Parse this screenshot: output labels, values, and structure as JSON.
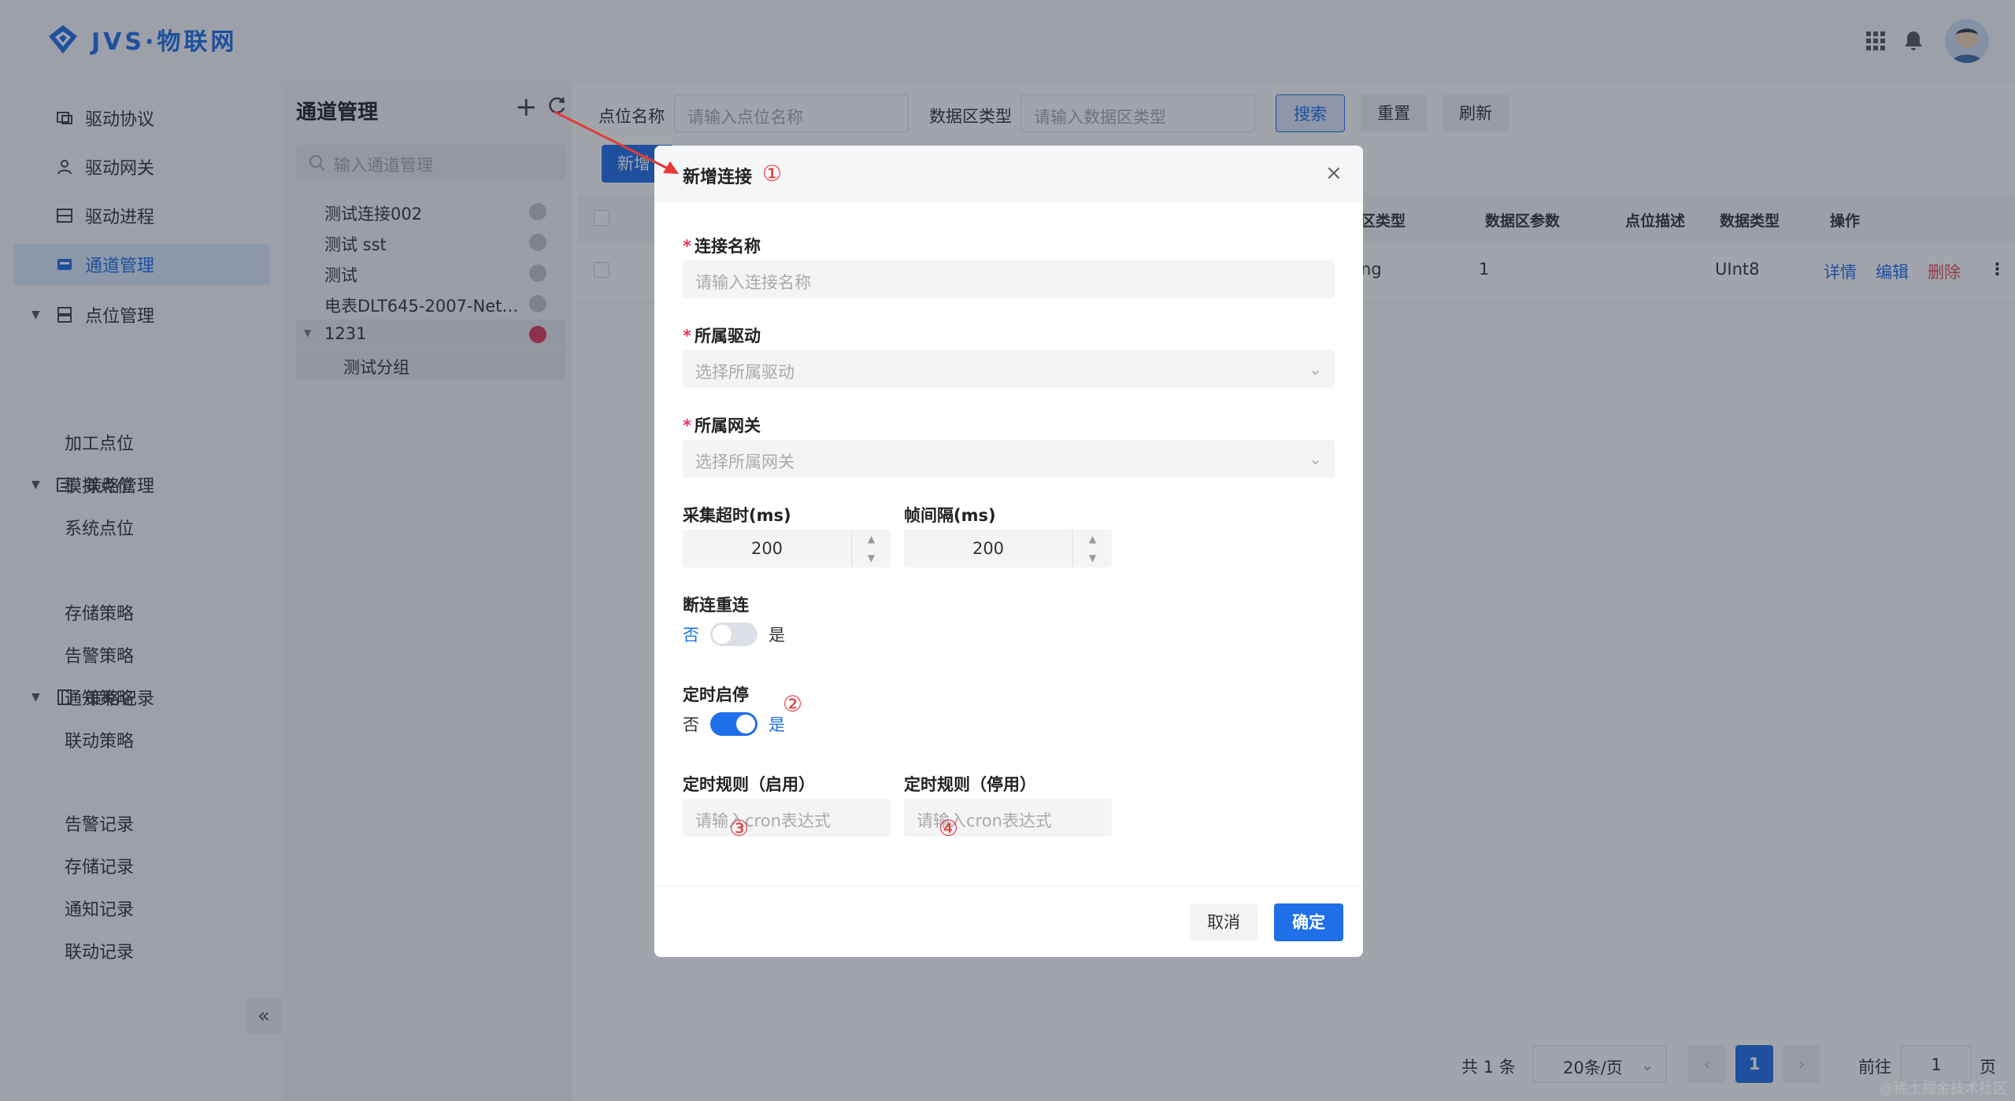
{
  "app": {
    "title": "JVS·物联网"
  },
  "nav": {
    "items": [
      {
        "label": "驱动协议",
        "icon": "protocol-icon"
      },
      {
        "label": "驱动网关",
        "icon": "gateway-icon"
      },
      {
        "label": "驱动进程",
        "icon": "process-icon"
      },
      {
        "label": "通道管理",
        "icon": "channel-icon",
        "active": true
      }
    ],
    "groups": [
      {
        "label": "点位管理",
        "icon": "point-icon",
        "children": [
          "加工点位",
          "模拟点位",
          "系统点位"
        ]
      },
      {
        "label": "策略管理",
        "icon": "strategy-icon",
        "children": [
          "存储策略",
          "告警策略",
          "通知策略",
          "联动策略"
        ]
      },
      {
        "label": "策略记录",
        "icon": "record-icon",
        "children": [
          "告警记录",
          "存储记录",
          "通知记录",
          "联动记录"
        ]
      }
    ],
    "collapse": "«"
  },
  "tree": {
    "title": "通道管理",
    "search_placeholder": "输入通道管理",
    "nodes": [
      "测试连接002",
      "测试 sst",
      "测试",
      "电表DLT645-2007-Net…",
      "1231",
      "测试分组"
    ]
  },
  "filters": {
    "point_name_label": "点位名称",
    "point_name_placeholder": "请输入点位名称",
    "data_type_label": "数据区类型",
    "data_type_placeholder": "请输入数据区类型",
    "search": "搜索",
    "reset": "重置",
    "refresh": "刷新",
    "new": "新增"
  },
  "table": {
    "headers": [
      "区类型",
      "数据区参数",
      "点位描述",
      "数据类型",
      "操作"
    ],
    "row": {
      "type": "ng",
      "param": "1",
      "dtype": "UInt8",
      "detail": "详情",
      "edit": "编辑",
      "delete": "删除"
    }
  },
  "pager": {
    "total": "共 1 条",
    "size": "20条/页",
    "current": "1",
    "goto": "前往",
    "page_input": "1",
    "page_unit": "页"
  },
  "dialog": {
    "title": "新增连接",
    "close": "×",
    "conn_name_label": "连接名称",
    "conn_name_placeholder": "请输入连接名称",
    "driver_label": "所属驱动",
    "driver_placeholder": "选择所属驱动",
    "gateway_label": "所属网关",
    "gateway_placeholder": "选择所属网关",
    "timeout_label": "采集超时(ms)",
    "timeout_value": "200",
    "interval_label": "帧间隔(ms)",
    "interval_value": "200",
    "reconnect_label": "断连重连",
    "reconnect_on": false,
    "schedule_label": "定时启停",
    "schedule_on": true,
    "switch_no": "否",
    "switch_yes": "是",
    "rule_start_label": "定时规则（启用）",
    "rule_stop_label": "定时规则（停用）",
    "cron_placeholder": "请输入cron表达式",
    "cancel": "取消",
    "ok": "确定"
  },
  "annotations": [
    "①",
    "②",
    "③",
    "④"
  ],
  "watermark": "@稀土掘金技术社区",
  "colors": {
    "primary": "#1e6fe8",
    "danger": "#e0395c",
    "annotation": "#e53935"
  }
}
